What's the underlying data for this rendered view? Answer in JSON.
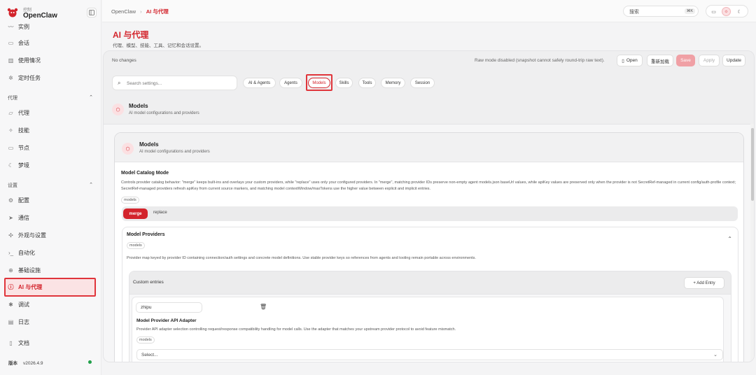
{
  "sidebar": {
    "brand_small": "控制",
    "brand_name": "OpenClaw",
    "items_top": [
      {
        "label": "实例",
        "icon": "pulse-icon"
      },
      {
        "label": "会话",
        "icon": "document-icon"
      },
      {
        "label": "使用情况",
        "icon": "bar-chart-icon"
      },
      {
        "label": "定时任务",
        "icon": "sparkle-icon"
      }
    ],
    "group_agents": "代理",
    "items_agents": [
      {
        "label": "代理",
        "icon": "folder-icon"
      },
      {
        "label": "技能",
        "icon": "bolt-icon"
      },
      {
        "label": "节点",
        "icon": "monitor-icon"
      },
      {
        "label": "梦境",
        "icon": "moon-icon"
      }
    ],
    "group_settings": "设置",
    "items_settings": [
      {
        "label": "配置",
        "icon": "gear-icon"
      },
      {
        "label": "通信",
        "icon": "send-icon"
      },
      {
        "label": "外观与设置",
        "icon": "palette-icon"
      },
      {
        "label": "自动化",
        "icon": "terminal-icon"
      },
      {
        "label": "基础设施",
        "icon": "globe-icon"
      },
      {
        "label": "AI 与代理",
        "icon": "ai-icon"
      },
      {
        "label": "调试",
        "icon": "bug-icon"
      },
      {
        "label": "日志",
        "icon": "log-icon"
      }
    ],
    "docs": "文档",
    "version_label": "版本",
    "version": "v2026.4.9",
    "status_color": "#22a04b"
  },
  "topbar": {
    "breadcrumb_root": "OpenClaw",
    "breadcrumb_sep": "›",
    "breadcrumb_current": "AI 与代理",
    "search_label": "搜索",
    "search_kbd": "⌘K"
  },
  "page": {
    "title": "AI 与代理",
    "subtitle": "代理、模型、技能、工具、记忆和会话设置。"
  },
  "toolbar": {
    "status": "No changes",
    "raw_mode": "Raw mode disabled (snapshot cannot safely round-trip raw text).",
    "open": "Open",
    "reload": "重新加载",
    "save": "Save",
    "apply": "Apply",
    "update": "Update"
  },
  "filters": {
    "search_placeholder": "Search settings...",
    "chips": [
      "AI & Agents",
      "Agents",
      "Models",
      "Skills",
      "Tools",
      "Memory",
      "Session"
    ],
    "active_chip": "Models"
  },
  "section": {
    "title": "Models",
    "desc": "AI model configurations and providers"
  },
  "card": {
    "title": "Models",
    "desc": "AI model configurations and providers",
    "catalog_mode": {
      "label": "Model Catalog Mode",
      "desc": "Controls provider catalog behavior: \"merge\" keeps built-ins and overlays your custom providers, while \"replace\" uses only your configured providers. In \"merge\", matching provider IDs preserve non-empty agent models.json baseUrl values, while apiKey values are preserved only when the provider is not SecretRef-managed in current config/auth-profile context; SecretRef-managed providers refresh apiKey from current source markers, and matching model contextWindow/maxTokens use the higher value between explicit and implicit entries.",
      "tag": "models",
      "options": [
        "merge",
        "replace"
      ],
      "selected": "merge"
    },
    "providers": {
      "label": "Model Providers",
      "tag": "models",
      "desc": "Provider map keyed by provider ID containing connection/auth settings and concrete model definitions. Use stable provider keys so references from agents and tooling remain portable across environments.",
      "custom_entries": "Custom entries",
      "add_entry": "+ Add Entry",
      "entry_key": "zhipu",
      "adapter_label": "Model Provider API Adapter",
      "adapter_desc": "Provider API adapter selection controlling request/response compatibility handling for model calls. Use the adapter that matches your upstream provider protocol to avoid feature mismatch.",
      "adapter_tag": "models",
      "adapter_select": "Select..."
    }
  },
  "colors": {
    "accent": "#d3242c",
    "save_bg": "#f0a0a5",
    "active_bg": "#fbe3e4",
    "highlight_border": "#e0353b"
  }
}
